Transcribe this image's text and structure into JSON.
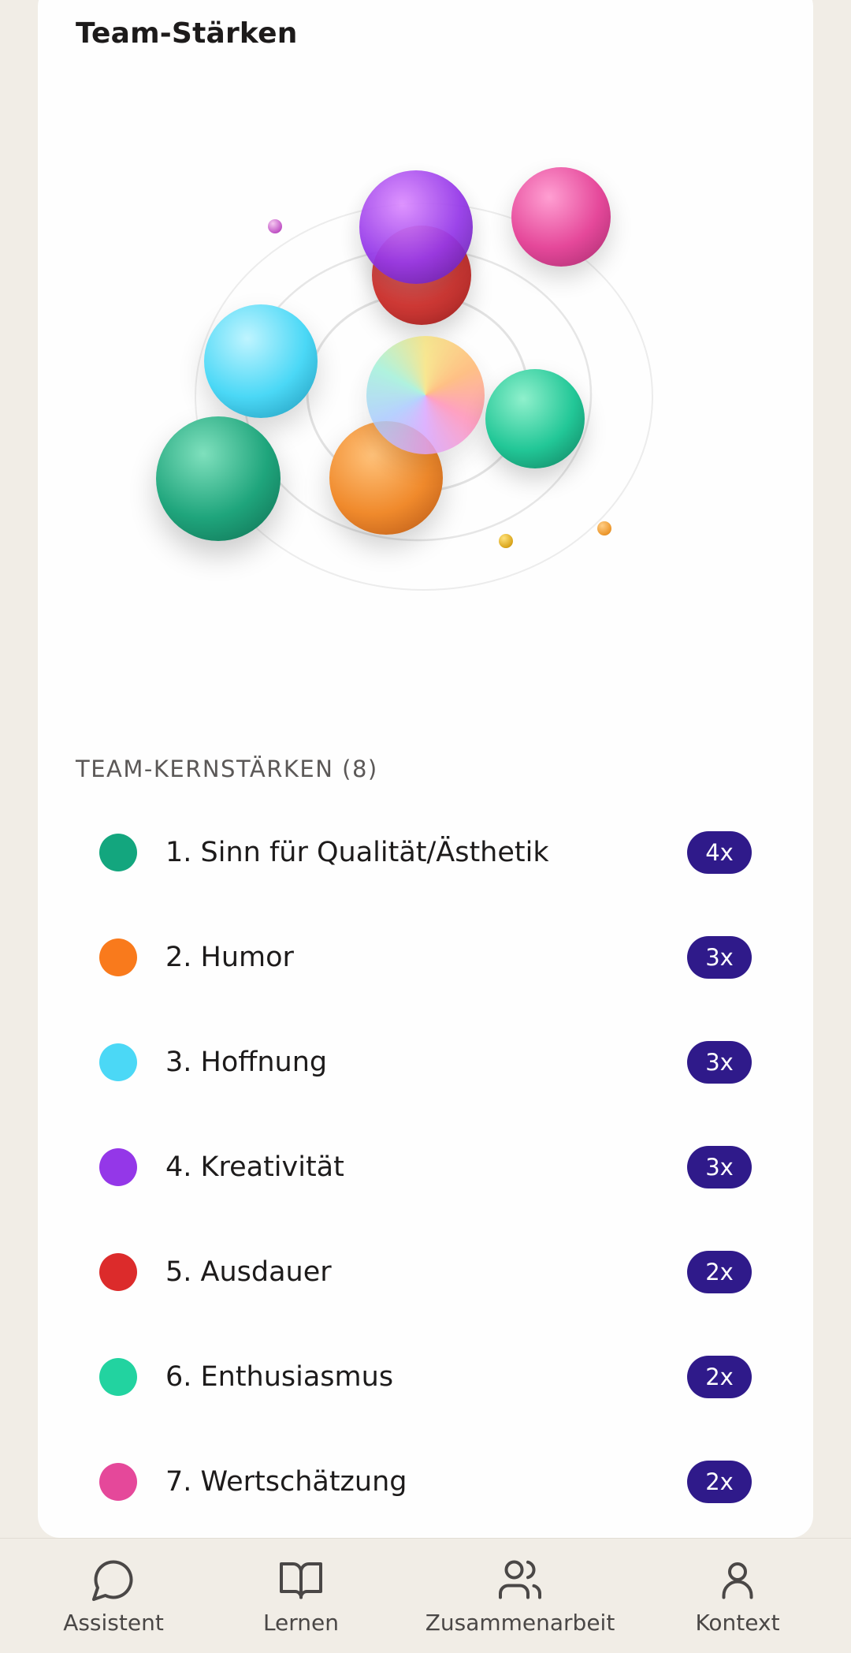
{
  "header": {
    "title": "Team-Stärken"
  },
  "core_strengths": {
    "heading": "TEAM-KERNSTÄRKEN (8)",
    "items": [
      {
        "label": "1. Sinn für Qualität/Ästhetik",
        "count": "4x",
        "color": "#13a67e"
      },
      {
        "label": "2. Humor",
        "count": "3x",
        "color": "#f97a1c"
      },
      {
        "label": "3. Hoffnung",
        "count": "3x",
        "color": "#4bd8f6"
      },
      {
        "label": "4. Kreativität",
        "count": "3x",
        "color": "#9437e8"
      },
      {
        "label": "5. Ausdauer",
        "count": "2x",
        "color": "#dc2b2b"
      },
      {
        "label": "6. Enthusiasmus",
        "count": "2x",
        "color": "#22d3a0"
      },
      {
        "label": "7. Wertschätzung",
        "count": "2x",
        "color": "#e5489a"
      }
    ]
  },
  "bottom_nav": {
    "items": [
      {
        "label": "Assistent",
        "icon": "chat-bubble-icon"
      },
      {
        "label": "Lernen",
        "icon": "book-icon"
      },
      {
        "label": "Zusammenarbeit",
        "icon": "users-icon"
      },
      {
        "label": "Kontext",
        "icon": "person-icon"
      }
    ]
  },
  "colors": {
    "accent": "#2f1a8a",
    "background": "#f1ede6"
  }
}
